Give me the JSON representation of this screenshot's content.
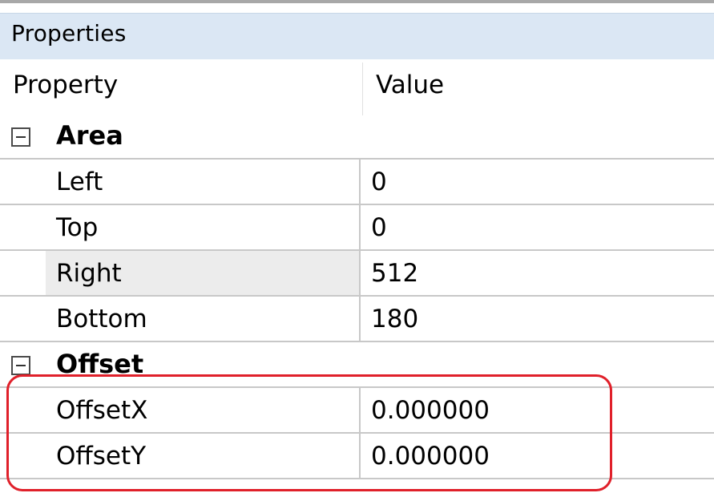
{
  "panel": {
    "title": "Properties",
    "columns": {
      "property": "Property",
      "value": "Value"
    }
  },
  "categories": [
    {
      "name": "Area",
      "rows": [
        {
          "name": "Left",
          "value": "0"
        },
        {
          "name": "Top",
          "value": "0"
        },
        {
          "name": "Right",
          "value": "512"
        },
        {
          "name": "Bottom",
          "value": "180"
        }
      ]
    },
    {
      "name": "Offset",
      "rows": [
        {
          "name": "OffsetX",
          "value": "0.000000"
        },
        {
          "name": "OffsetY",
          "value": "0.000000"
        }
      ]
    }
  ],
  "annotation": {
    "color": "#e0202a"
  }
}
